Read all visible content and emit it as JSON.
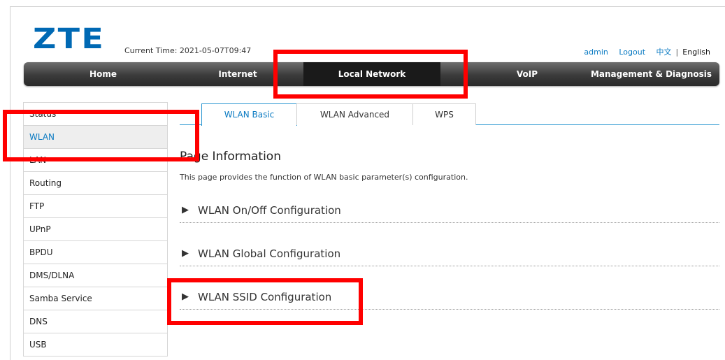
{
  "logo": "ZTE",
  "current_time": "Current Time: 2021-05-07T09:47",
  "top_links": {
    "user": "admin",
    "logout": "Logout",
    "lang_cn": "中文",
    "separator": "|",
    "lang_en": "English"
  },
  "nav": {
    "items": [
      "Home",
      "Internet",
      "Local Network",
      "VoIP",
      "Management & Diagnosis"
    ],
    "active": "Local Network"
  },
  "sidebar": {
    "items": [
      "Status",
      "WLAN",
      "LAN",
      "Routing",
      "FTP",
      "UPnP",
      "BPDU",
      "DMS/DLNA",
      "Samba Service",
      "DNS",
      "USB"
    ],
    "selected": "WLAN"
  },
  "tabs": [
    "WLAN Basic",
    "WLAN Advanced",
    "WPS"
  ],
  "active_tab": "WLAN Basic",
  "page_info": {
    "title": "Page Information",
    "description": "This page provides the function of WLAN basic parameter(s) configuration."
  },
  "sections": [
    "WLAN On/Off Configuration",
    "WLAN Global Configuration",
    "WLAN SSID Configuration"
  ],
  "colors": {
    "brand": "#0069b4",
    "accent": "#0a7ac2",
    "highlight": "#ff0000",
    "nav_bg": "#3b3b3b"
  }
}
